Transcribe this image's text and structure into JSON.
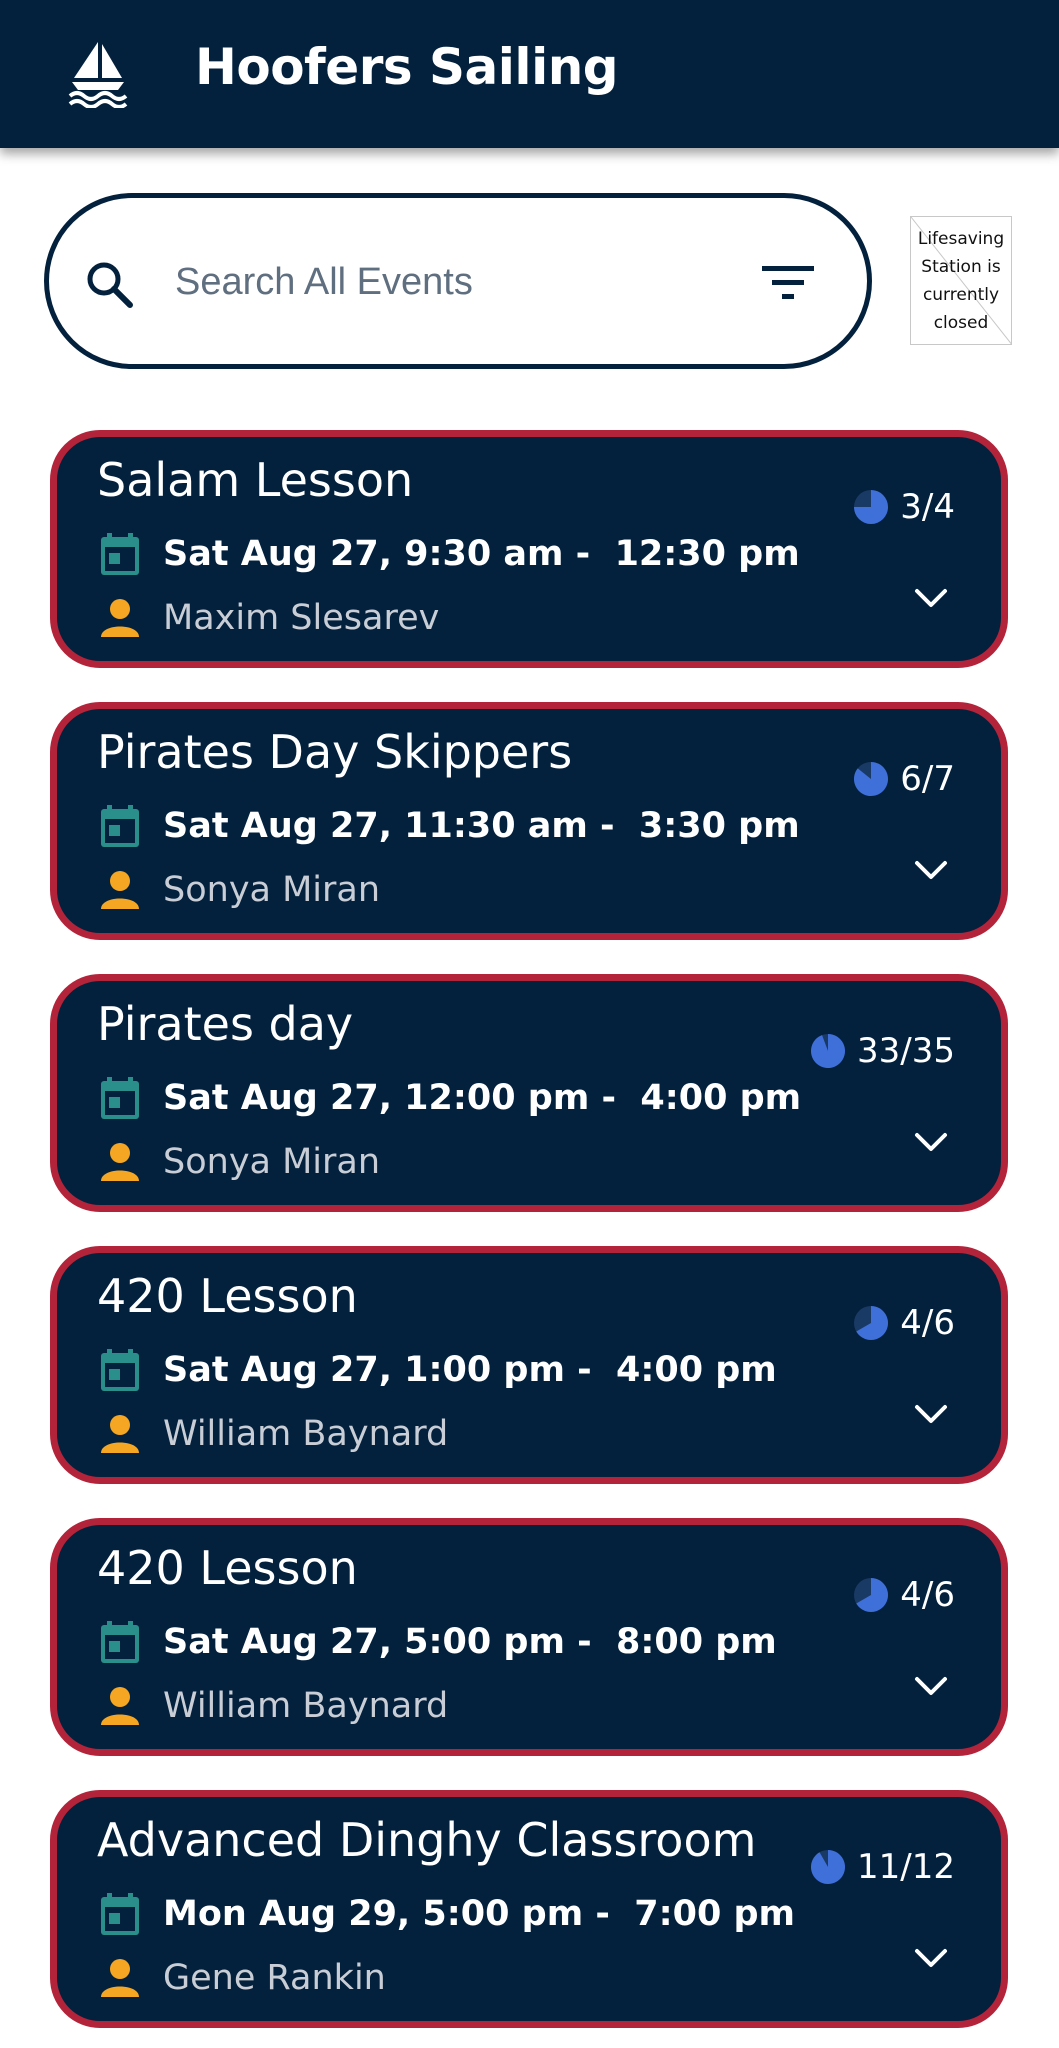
{
  "header": {
    "title": "Hoofers Sailing",
    "logo_icon": "sailboat-icon"
  },
  "search": {
    "placeholder": "Search All Events",
    "value": ""
  },
  "status_image_alt": [
    "Lifesaving",
    "Station is",
    "currently",
    "closed"
  ],
  "colors": {
    "navy": "#03213d",
    "card_border": "#b3243a",
    "calendar": "#2a8f8a",
    "person": "#f5a623",
    "pie": "#3f6fd8"
  },
  "events": [
    {
      "title": "Salam Lesson",
      "time": "Sat Aug 27, 9:30 am -  12:30 pm",
      "person": "Maxim Slesarev",
      "capacity": "3/4",
      "filled_fraction": 0.75
    },
    {
      "title": "Pirates Day Skippers",
      "time": "Sat Aug 27, 11:30 am -  3:30 pm",
      "person": "Sonya Miran",
      "capacity": "6/7",
      "filled_fraction": 0.857
    },
    {
      "title": "Pirates day",
      "time": "Sat Aug 27, 12:00 pm -  4:00 pm",
      "person": "Sonya Miran",
      "capacity": "33/35",
      "filled_fraction": 0.943
    },
    {
      "title": "420 Lesson",
      "time": "Sat Aug 27, 1:00 pm -  4:00 pm",
      "person": "William Baynard",
      "capacity": "4/6",
      "filled_fraction": 0.667
    },
    {
      "title": "420 Lesson",
      "time": "Sat Aug 27, 5:00 pm -  8:00 pm",
      "person": "William Baynard",
      "capacity": "4/6",
      "filled_fraction": 0.667
    },
    {
      "title": "Advanced Dinghy Classroom",
      "time": "Mon Aug 29, 5:00 pm -  7:00 pm",
      "person": "Gene Rankin",
      "capacity": "11/12",
      "filled_fraction": 0.917
    }
  ]
}
